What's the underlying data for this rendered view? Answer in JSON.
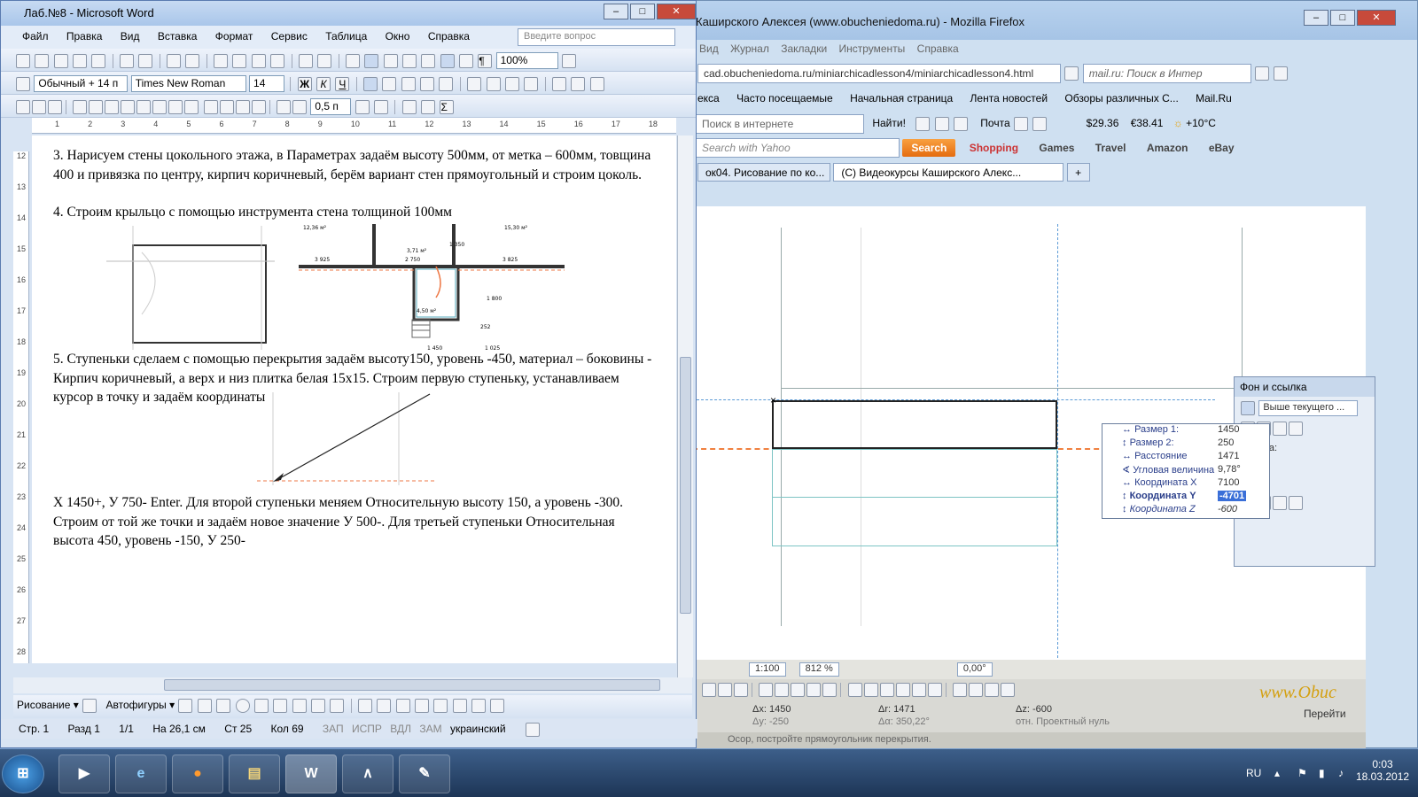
{
  "word": {
    "title": "Лаб.№8 - Microsoft Word",
    "menu": [
      "Файл",
      "Правка",
      "Вид",
      "Вставка",
      "Формат",
      "Сервис",
      "Таблица",
      "Окно",
      "Справка"
    ],
    "ask_placeholder": "Введите вопрос",
    "zoom": "100%",
    "style": "Обычный + 14 п",
    "font": "Times New Roman",
    "font_size": "14",
    "line_spacing": "0,5 п",
    "ruler_marks": [
      "1",
      "2",
      "3",
      "4",
      "5",
      "6",
      "7",
      "8",
      "9",
      "10",
      "11",
      "12",
      "13",
      "14",
      "15",
      "16",
      "17",
      "18"
    ],
    "vruler_marks": [
      "12",
      "13",
      "14",
      "15",
      "16",
      "17",
      "18",
      "19",
      "20",
      "21",
      "22",
      "23",
      "24",
      "25",
      "26",
      "27",
      "28"
    ],
    "paragraphs": [
      "3. Нарисуем стены цокольного этажа, в Параметрах задаём высоту 500мм, от метка – 600мм, товщина 400 и привязка по центру, кирпич коричневый, берём вариант стен прямоугольный и строим цоколь.",
      "4. Строим крыльцо с помощью инструмента стена толщиной 100мм",
      "5. Ступеньки сделаем с помощью перекрытия задаём  высоту150, уровень -450, материал – боковины - Кирпич коричневый, а верх и низ плитка белая 15х15. Строим первую ступеньку, устанавливаем курсор в точку и задаём координаты",
      "X 1450+, У 750- Enter. Для второй ступеньки меняем Относительную высоту 150, а уровень -300. Строим от той же точки и задаём новое значение У 500-. Для третьей ступеньки Относительная высота 450, уровень -150, У 250-"
    ],
    "plan_labels": [
      "12,36 м²",
      "3,71 м²",
      "15,30 м²",
      "3 925",
      "2 750",
      "3 825",
      "1 350",
      "1 800",
      "4,50 м²",
      "1 450",
      "1 025",
      "252"
    ],
    "drawbar": {
      "draw": "Рисование",
      "autoshapes": "Автофигуры"
    },
    "status": {
      "page": "Стр. 1",
      "section": "Разд 1",
      "pages": "1/1",
      "at": "На 26,1 см",
      "line": "Ст 25",
      "col": "Кол 69",
      "rec": "ЗАП",
      "trk": "ИСПР",
      "ext": "ВДЛ",
      "ovr": "ЗАМ",
      "lang": "украинский"
    }
  },
  "firefox": {
    "title": "Кaширского Алексея (www.obucheniedoma.ru) - Mozilla Firefox",
    "menu": [
      "Вид",
      "Журнал",
      "Закладки",
      "Инструменты",
      "Справка"
    ],
    "url": "cad.obucheniedoma.ru/miniarchicadlesson4/miniarchicadlesson4.html",
    "search_placeholder": "mail.ru: Поиск в Интер",
    "bookmarks": [
      "екса",
      "Часто посещаемые",
      "Начальная страница",
      "Лента новостей",
      "Обзоры различных С...",
      "Mail.Ru"
    ],
    "toolbar2": {
      "placeholder": "Поиск в интернете",
      "find": "Найти!",
      "mail": "Почта",
      "dollar": "29.36",
      "euro": "38.41",
      "weather": "+10°C"
    },
    "yahoo": {
      "placeholder": "Search with Yahoo",
      "search": "Search",
      "shopping": "Shopping",
      "games": "Games",
      "travel": "Travel",
      "amazon": "Amazon",
      "ebay": "eBay"
    },
    "tabs": [
      "ок04. Рисование по ко...",
      "(С) Видеокурсы Каширского Алекс..."
    ]
  },
  "archicad": {
    "scale": "1:100",
    "zoom": "812 %",
    "angle": "0,00°",
    "coords": {
      "dx": "Δx: 1450",
      "dy": "Δy: -250",
      "dr": "Δr: 1471",
      "da": "Δα: 350,22°",
      "dz": "Δz: -600",
      "ref": "отн. Проектный нуль"
    },
    "hint": "Осор, постройте прямоугольник перекрытия.",
    "watermark": "www.Obuc",
    "fon_title": "Фон и ссылка",
    "fon_btn": "Выше текущего ...",
    "fon_link": "Ссылка:",
    "tracker": [
      {
        "label": "Размер 1:",
        "value": "1450"
      },
      {
        "label": "Размер 2:",
        "value": "250"
      },
      {
        "label": "Расстояние",
        "value": "1471"
      },
      {
        "label": "Угловая величина",
        "value": "9,78°"
      },
      {
        "label": "Координата X",
        "value": "7100"
      },
      {
        "label": "Координата Y",
        "value": "-4701"
      },
      {
        "label": "Координата Z",
        "value": "-600"
      }
    ],
    "next_btn": "Перейти"
  },
  "taskbar": {
    "lang": "RU",
    "time": "0:03",
    "date": "18.03.2012"
  }
}
